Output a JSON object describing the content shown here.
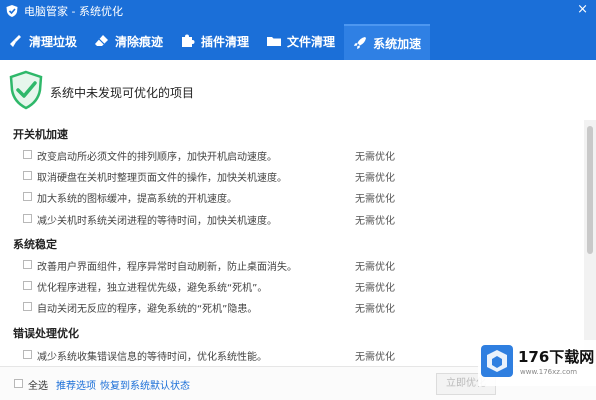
{
  "window": {
    "title": "电脑管家 - 系统优化",
    "close_glyph": "×"
  },
  "tabs": [
    {
      "label": "清理垃圾",
      "icon": "broom-icon"
    },
    {
      "label": "清除痕迹",
      "icon": "eraser-icon"
    },
    {
      "label": "插件清理",
      "icon": "puzzle-icon"
    },
    {
      "label": "文件清理",
      "icon": "folder-icon"
    },
    {
      "label": "系统加速",
      "icon": "rocket-icon",
      "active": true
    }
  ],
  "header": {
    "message": "系统中未发现可优化的项目"
  },
  "sections": [
    {
      "title": "开关机加速",
      "items": [
        {
          "desc": "改变启动所必须文件的排列顺序，加快开机启动速度。",
          "status": "无需优化"
        },
        {
          "desc": "取消硬盘在关机时整理页面文件的操作，加快关机速度。",
          "status": "无需优化"
        },
        {
          "desc": "加大系统的图标缓冲，提高系统的开机速度。",
          "status": "无需优化"
        },
        {
          "desc": "减少关机时系统关闭进程的等待时间，加快关机速度。",
          "status": "无需优化"
        }
      ]
    },
    {
      "title": "系统稳定",
      "items": [
        {
          "desc": "改善用户界面组件，程序异常时自动刷新，防止桌面消失。",
          "status": "无需优化"
        },
        {
          "desc": "优化程序进程，独立进程优先级，避免系统“死机”。",
          "status": "无需优化"
        },
        {
          "desc": "自动关闭无反应的程序，避免系统的“死机”隐患。",
          "status": "无需优化"
        }
      ]
    },
    {
      "title": "错误处理优化",
      "items": [
        {
          "desc": "减少系统收集错误信息的等待时间，优化系统性能。",
          "status": "无需优化"
        }
      ]
    }
  ],
  "footer": {
    "select_all": "全选",
    "recommend": "推荐选项",
    "restore": "恢复到系统默认状态",
    "optimize_button": "立即优化"
  },
  "watermark": {
    "text": "176下载网",
    "sub": "www.176xz.com"
  },
  "colors": {
    "brand": "#1b6fd8",
    "active_tab": "#2f80e4",
    "shield": "#2fb86a",
    "link": "#1b6fd8"
  }
}
